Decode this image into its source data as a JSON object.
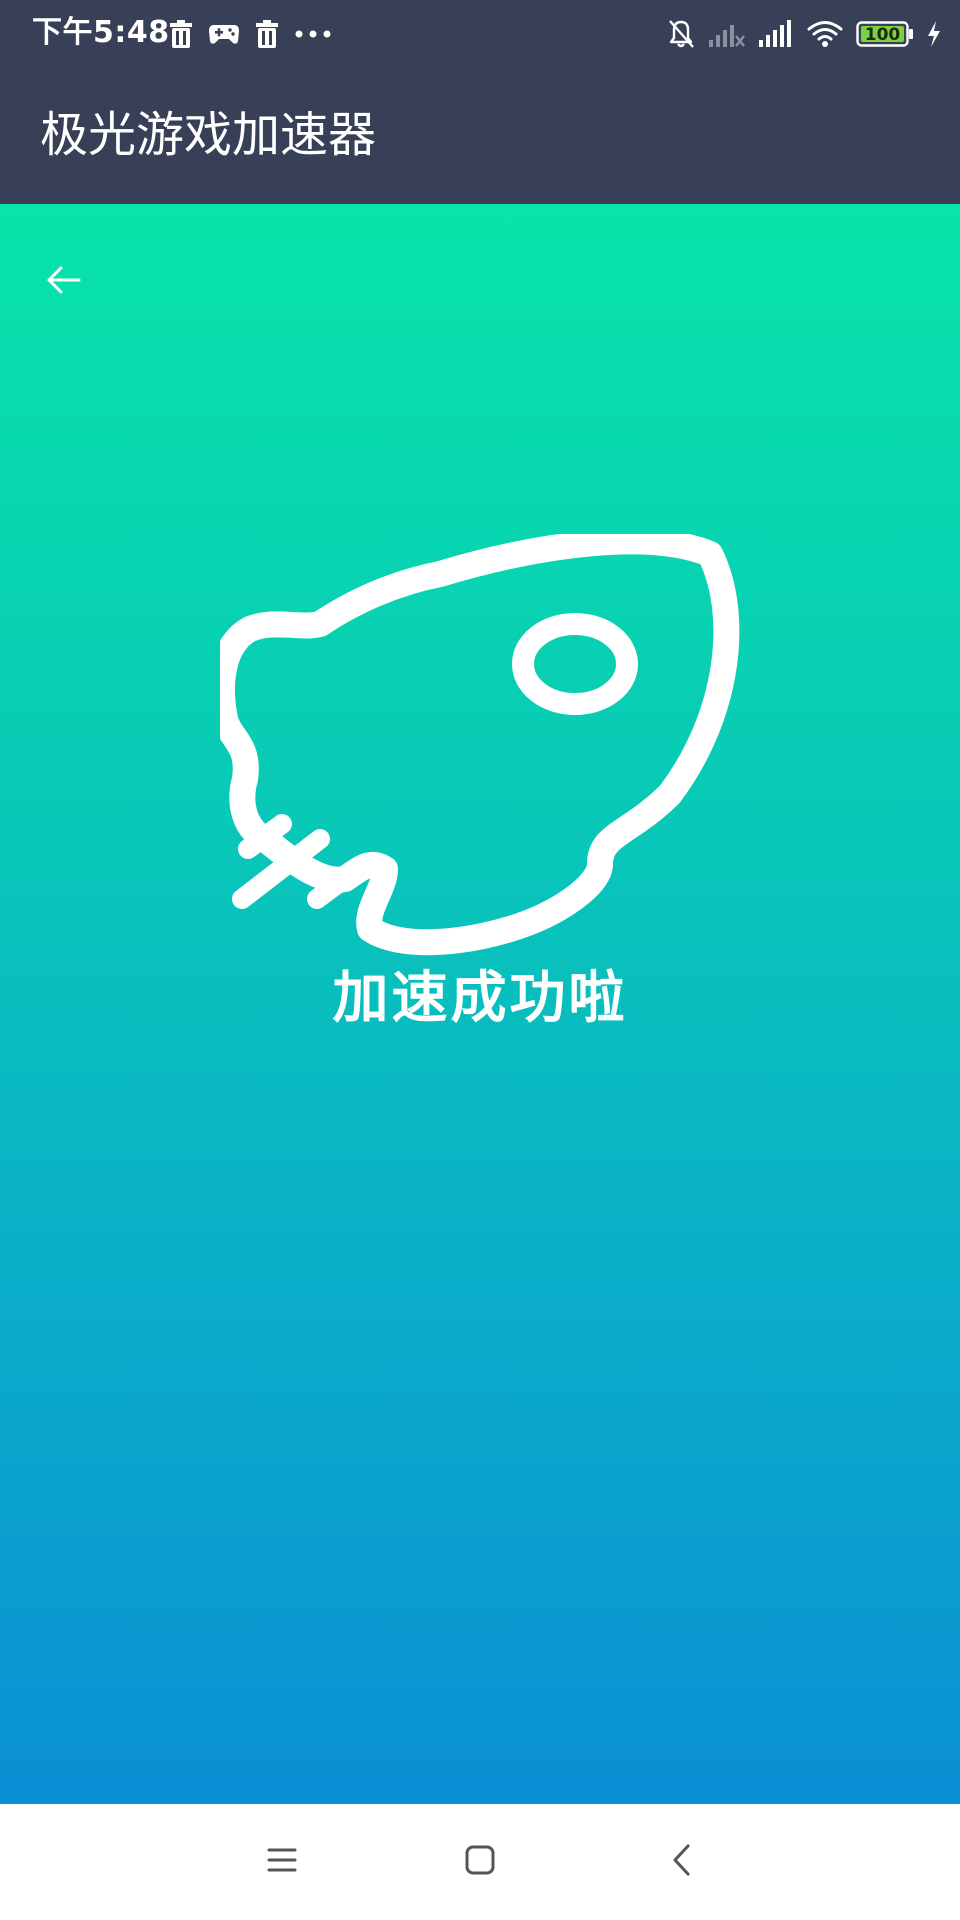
{
  "status_bar": {
    "time": "下午5:48",
    "battery_level": "100",
    "left_icons": [
      "trash-icon",
      "gamepad-icon",
      "trash-icon",
      "more-dots-icon"
    ],
    "right_icons": [
      "bell-off-icon",
      "signal-weak-icon",
      "signal-full-icon",
      "wifi-icon",
      "battery-icon",
      "charging-icon"
    ]
  },
  "app_bar": {
    "title": "极光游戏加速器"
  },
  "content": {
    "back_icon": "arrow-left-icon",
    "illustration": "rocket-icon",
    "message": "加速成功啦"
  },
  "nav_bar": {
    "icons": [
      "menu-icon",
      "home-icon",
      "back-chevron-icon"
    ]
  },
  "colors": {
    "bar_background": "#374056",
    "gradient_top": "#08e4aa",
    "gradient_bottom": "#0a8fd4",
    "text_light": "#ffffff",
    "battery_fill": "#7cd23c"
  }
}
